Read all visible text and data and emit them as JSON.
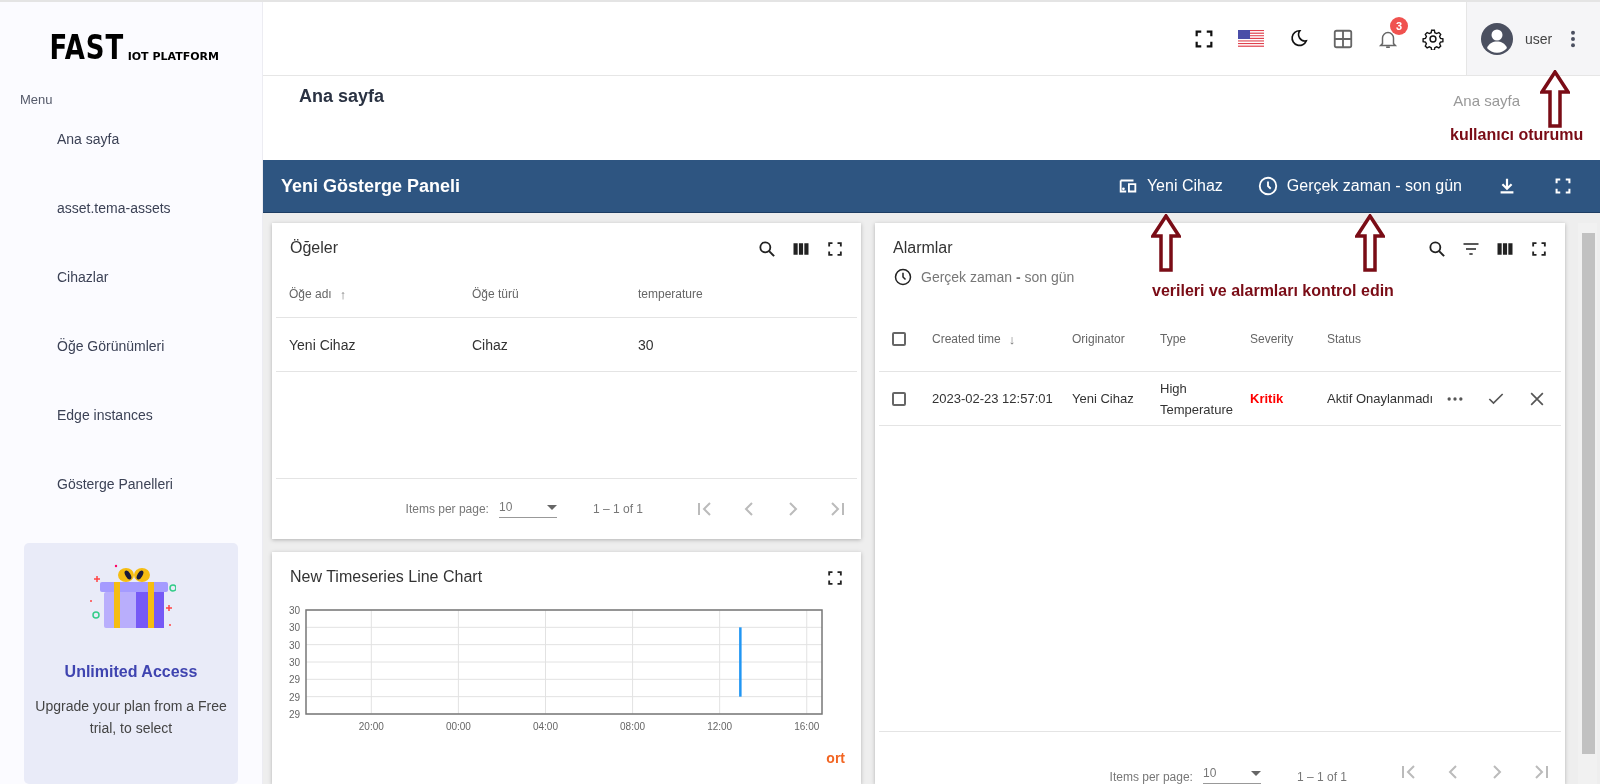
{
  "logo": {
    "main": "FAST",
    "sub": "IOT PLATFORM"
  },
  "sidebar": {
    "heading": "Menu",
    "items": [
      {
        "label": "Ana sayfa"
      },
      {
        "label": "asset.tema-assets"
      },
      {
        "label": "Cihazlar"
      },
      {
        "label": "Öğe Görünümleri"
      },
      {
        "label": "Edge instances"
      },
      {
        "label": "Gösterge Panelleri"
      }
    ],
    "promo": {
      "title": "Unlimited Access",
      "text": "Upgrade your plan from a Free trial, to select"
    }
  },
  "topbar": {
    "notification_count": "3",
    "user": "user"
  },
  "page": {
    "title": "Ana sayfa",
    "breadcrumb": "Ana sayfa"
  },
  "dashboard_bar": {
    "title": "Yeni Gösterge Paneli",
    "device": "Yeni Cihaz",
    "timewindow": "Gerçek zaman - son gün"
  },
  "entities_widget": {
    "title": "Öğeler",
    "columns": [
      {
        "label": "Öğe adı",
        "sort_arrow": "↑"
      },
      {
        "label": "Öğe türü"
      },
      {
        "label": "temperature"
      }
    ],
    "rows": [
      [
        "Yeni Cihaz",
        "Cihaz",
        "30"
      ]
    ],
    "pagination": {
      "label": "Items per page:",
      "page_size": "10",
      "range": "1 – 1 of 1"
    }
  },
  "alarms_widget": {
    "title": "Alarmlar",
    "timewindow": "Gerçek zaman **-** son gün",
    "all_checked": false,
    "columns": [
      {
        "label": "Created time",
        "sort_arrow": "↓"
      },
      {
        "label": "Originator"
      },
      {
        "label": "Type"
      },
      {
        "label": "Severity"
      },
      {
        "label": "Status"
      }
    ],
    "rows": [
      {
        "checked": false,
        "created": "2023-02-23 12:57:01",
        "originator": "Yeni Cihaz",
        "type": "High Temperature",
        "severity": "Kritik",
        "color": "#ff0000",
        "status": "Aktif Onaylanmadı"
      }
    ],
    "pagination": {
      "label": "Items per page:",
      "page_size": "10",
      "range": "1 – 1 of 1"
    }
  },
  "chart_widget": {
    "title": "New Timeseries Line Chart",
    "chart_data": {
      "type": "line",
      "grid": true,
      "xlim": [
        "2023-02-22T17:00",
        "2023-02-23T16:42"
      ],
      "ylim": [
        29.0,
        30.2
      ],
      "xticks": [
        {
          "value": "2023-02-22T20:00",
          "label": "20:00"
        },
        {
          "value": "2023-02-23T00:00",
          "label": "00:00"
        },
        {
          "value": "2023-02-23T04:00",
          "label": "04:00"
        },
        {
          "value": "2023-02-23T08:00",
          "label": "08:00"
        },
        {
          "value": "2023-02-23T12:00",
          "label": "12:00"
        },
        {
          "value": "2023-02-23T16:00",
          "label": "16:00"
        }
      ],
      "yticks": [
        {
          "value": 29.0,
          "label": "29"
        },
        {
          "value": 29.2,
          "label": "29"
        },
        {
          "value": 29.4,
          "label": "29"
        },
        {
          "value": 29.6,
          "label": "30"
        },
        {
          "value": 29.8,
          "label": "30"
        },
        {
          "value": 30.0,
          "label": "30"
        },
        {
          "value": 30.2,
          "label": "30"
        }
      ],
      "x": [
        "2023-02-23T12:57",
        "2023-02-23T12:57"
      ],
      "series": [
        {
          "name": "ort",
          "color": "#2196f3",
          "values": [
            30.0,
            29.2
          ]
        }
      ]
    }
  },
  "annotations": [
    {
      "text": "kullanıcı oturumu"
    },
    {
      "text": "verileri ve alarmları kontrol edin"
    }
  ]
}
